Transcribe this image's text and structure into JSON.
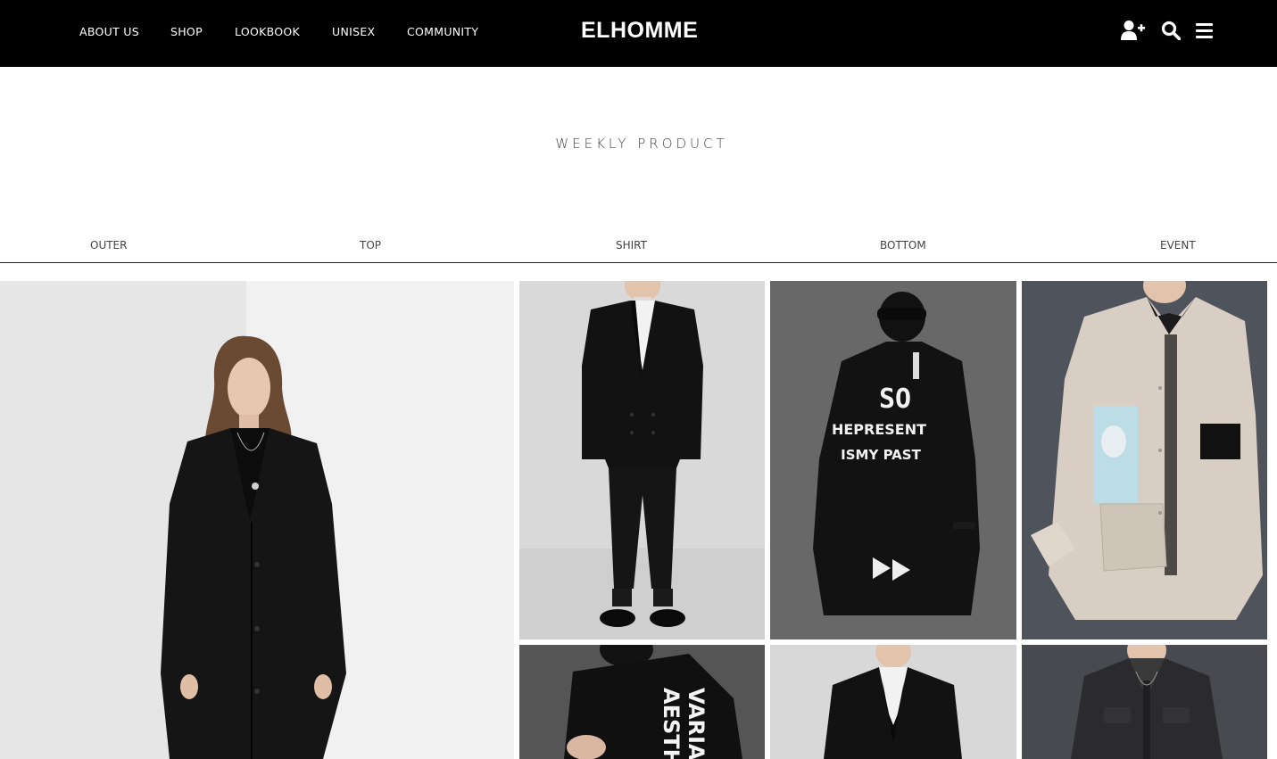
{
  "header": {
    "nav": [
      "ABOUT US",
      "SHOP",
      "LOOKBOOK",
      "UNISEX",
      "COMMUNITY"
    ],
    "logo": "ELHOMME",
    "icons": [
      "user-plus-icon",
      "search-icon",
      "menu-icon"
    ]
  },
  "section": {
    "title": "WEEKLY PRODUCT"
  },
  "tabs": [
    "OUTER",
    "TOP",
    "SHIRT",
    "BOTTOM",
    "EVENT"
  ],
  "products": {
    "graphic_coat_text": [
      "SO",
      "HEPRESENT",
      "ISMY PAST"
    ],
    "side_text": [
      "AESTHE",
      "VARIA"
    ]
  },
  "colors": {
    "header_bg": "#000000",
    "header_text": "#ffffff",
    "divider": "#222222"
  }
}
